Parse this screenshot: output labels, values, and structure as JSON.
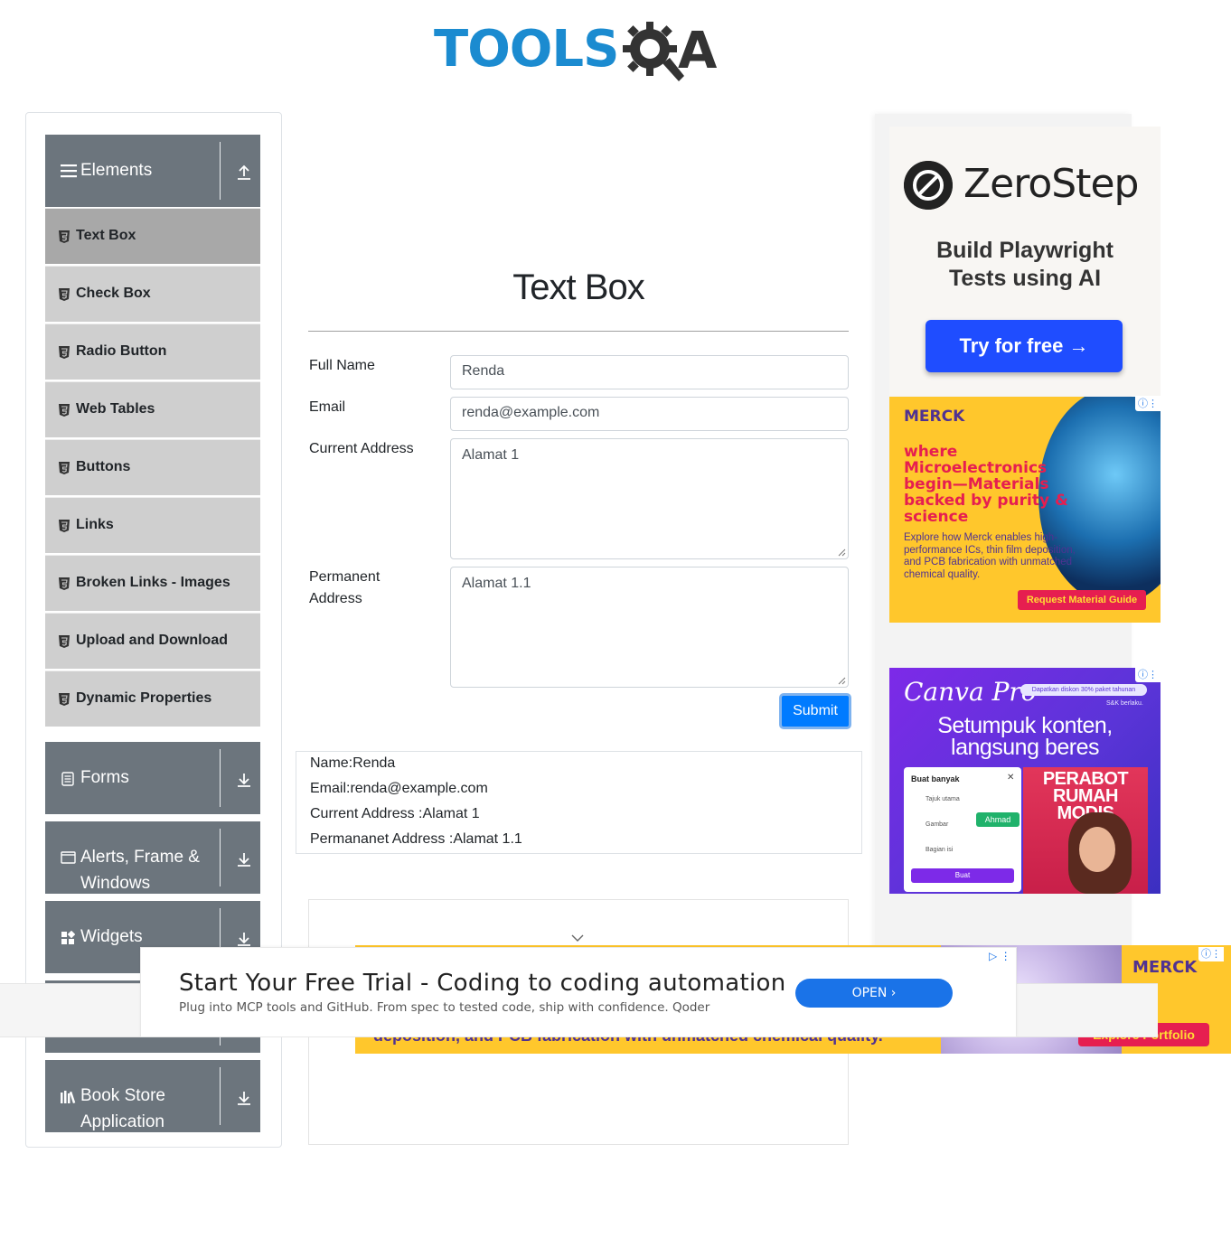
{
  "header": {
    "logo_left": "TOOLS",
    "logo_right": "A",
    "logo_alt": "TOOLSQA"
  },
  "sidebar": {
    "groups": [
      {
        "label": "Elements",
        "icon": "hamburger-icon",
        "arrow": "upload-arrow-icon"
      },
      {
        "label": "Forms",
        "icon": "document-icon",
        "arrow": "download-arrow-icon"
      },
      {
        "label": "Alerts, Frame &",
        "label2": "Windows",
        "icon": "window-icon",
        "arrow": "download-arrow-icon"
      },
      {
        "label": "Widgets",
        "icon": "widgets-icon",
        "arrow": "download-arrow-icon"
      },
      {
        "label": "Book Store",
        "label2": "Application",
        "icon": "books-icon",
        "arrow": "download-arrow-icon"
      }
    ],
    "items": [
      {
        "label": "Text Box",
        "active": true
      },
      {
        "label": "Check Box"
      },
      {
        "label": "Radio Button"
      },
      {
        "label": "Web Tables"
      },
      {
        "label": "Buttons"
      },
      {
        "label": "Links"
      },
      {
        "label": "Broken Links - Images"
      },
      {
        "label": "Upload and Download"
      },
      {
        "label": "Dynamic Properties"
      }
    ]
  },
  "main": {
    "title": "Text Box",
    "form": {
      "full_name_label": "Full Name",
      "full_name_value": "Renda",
      "email_label": "Email",
      "email_value": "renda@example.com",
      "current_address_label": "Current Address",
      "current_address_value": "Alamat 1",
      "permanent_address_label_1": "Permanent",
      "permanent_address_label_2": "Address",
      "permanent_address_value": "Alamat 1.1",
      "submit_label": "Submit"
    },
    "output": {
      "name": "Name:Renda",
      "email": "Email:renda@example.com",
      "current_address": "Current Address :Alamat 1",
      "permanent_address": "Permananet Address :Alamat 1.1"
    }
  },
  "ads": {
    "zerostep": {
      "name": "ZeroStep",
      "tagline_1": "Build Playwright",
      "tagline_2": "Tests using AI",
      "cta": "Try for free →"
    },
    "merck": {
      "logo": "MERCK",
      "headline": "where Microelectronics begin—Materials backed by purity & science",
      "body": "Explore how Merck enables high-performance ICs, thin film deposition, and PCB fabrication with unmatched chemical quality.",
      "cta": "Request Material Guide"
    },
    "canva": {
      "logo": "Canva Pro",
      "pill": "Dapatkan diskon 30% paket tahunan",
      "small": "S&K berlaku.",
      "headline_1": "Setumpuk konten,",
      "headline_2": "langsung beres",
      "panel_title": "Buat banyak",
      "panel_row_1": "Tajuk utama",
      "panel_row_2": "Gambar",
      "panel_row_3": "Bagian isi",
      "panel_tag": "Ahmad",
      "panel_button": "Buat",
      "photo_text_1": "PERABOT",
      "photo_text_2": "RUMAH MODIS"
    },
    "bottom": {
      "title": "Start Your Free Trial - Coding to coding automation",
      "subtitle": "Plug into MCP tools and GitHub. From spec to tested code, ship with confidence. Qoder",
      "cta": "OPEN  ›",
      "back_merck": "MERCK",
      "back_cta": "Explore Portfolio",
      "back_text": "deposition, and PCB fabrication with unmatched chemical quality."
    }
  }
}
